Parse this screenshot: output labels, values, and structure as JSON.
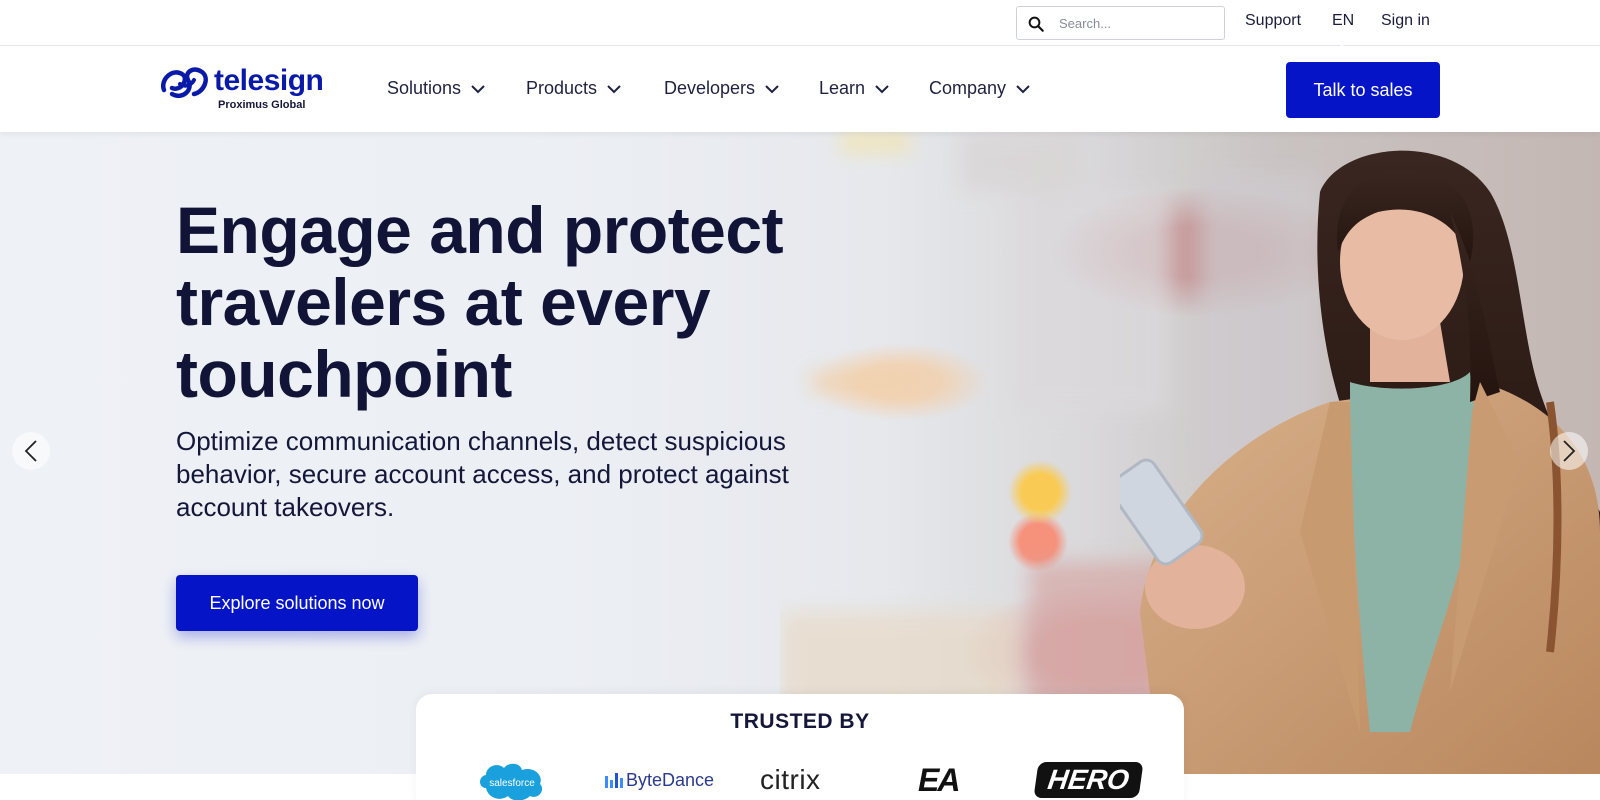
{
  "utility": {
    "search_placeholder": "Search...",
    "support": "Support",
    "language": "EN",
    "sign_in": "Sign in"
  },
  "logo": {
    "name": "telesign",
    "tagline": "Proximus Global"
  },
  "nav": {
    "items": [
      {
        "label": "Solutions"
      },
      {
        "label": "Products"
      },
      {
        "label": "Developers"
      },
      {
        "label": "Learn"
      },
      {
        "label": "Company"
      }
    ],
    "cta": "Talk to sales"
  },
  "hero": {
    "title": "Engage and protect travelers at every touchpoint",
    "subtitle": "Optimize communication channels, detect suspicious behavior, secure account access, and protect against account takeovers.",
    "cta": "Explore solutions now"
  },
  "trusted": {
    "title": "TRUSTED BY",
    "brands": [
      "salesforce",
      "ByteDance",
      "citrix",
      "EA",
      "HERO"
    ]
  },
  "colors": {
    "brand_blue": "#0614c8",
    "logo_blue": "#0a1aa8",
    "text_dark": "#111436"
  },
  "icons": {
    "search": "search-icon",
    "chevron": "chevron-down-icon",
    "prev": "chevron-left-icon",
    "next": "chevron-right-icon"
  }
}
